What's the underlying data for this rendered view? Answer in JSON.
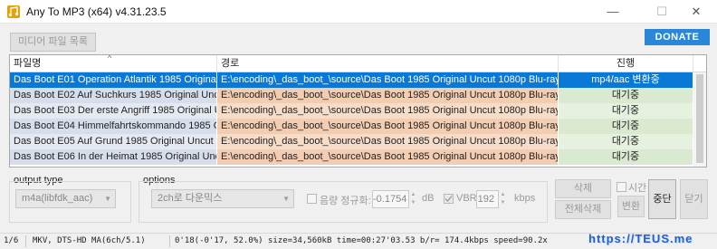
{
  "window": {
    "title": "Any To MP3 (x64) v4.31.23.5",
    "minimize": "—",
    "maximize": "☐",
    "close": "✕"
  },
  "toolbar": {
    "media_list_label": "미디어 파일 목록",
    "donate_label": "DONATE"
  },
  "grid": {
    "columns": [
      "파일명",
      "경로",
      "진행"
    ],
    "rows": [
      {
        "name": "Das Boot E01 Operation Atlantik 1985 Original ...",
        "path": "E:\\encoding\\_das_boot_\\source\\Das Boot 1985 Original Uncut 1080p Blu-ray Re...",
        "status": "mp4/aac 변환중",
        "selected": true
      },
      {
        "name": "Das Boot E02 Auf Suchkurs 1985 Original Uncut...",
        "path": "E:\\encoding\\_das_boot_\\source\\Das Boot 1985 Original Uncut 1080p Blu-ray Re...",
        "status": "대기중",
        "selected": false
      },
      {
        "name": "Das Boot E03 Der erste Angriff 1985 Original U...",
        "path": "E:\\encoding\\_das_boot_\\source\\Das Boot 1985 Original Uncut 1080p Blu-ray Re...",
        "status": "대기중",
        "selected": false
      },
      {
        "name": "Das Boot E04 Himmelfahrtskommando 1985 Or...",
        "path": "E:\\encoding\\_das_boot_\\source\\Das Boot 1985 Original Uncut 1080p Blu-ray Re...",
        "status": "대기중",
        "selected": false
      },
      {
        "name": "Das Boot E05 Auf Grund 1985 Original Uncut 1...",
        "path": "E:\\encoding\\_das_boot_\\source\\Das Boot 1985 Original Uncut 1080p Blu-ray Re...",
        "status": "대기중",
        "selected": false
      },
      {
        "name": "Das Boot E06 In der Heimat 1985 Original Uncu...",
        "path": "E:\\encoding\\_das_boot_\\source\\Das Boot 1985 Original Uncut 1080p Blu-ray Re...",
        "status": "대기중",
        "selected": false
      }
    ]
  },
  "output": {
    "group_label": "output type",
    "format": "m4a(libfdk_aac)"
  },
  "options": {
    "group_label": "options",
    "downmix": "2ch로 다운믹스",
    "normalize_label": "음량 정규화:",
    "normalize_value": "-0.1754",
    "db_unit": "dB",
    "vbr_label": "VBR",
    "vbr_value": "192",
    "kbps_unit": "kbps"
  },
  "actions": {
    "delete": "삭제",
    "delete_all": "전체삭제",
    "time_label": "시간",
    "convert": "변환",
    "stop": "중단",
    "close": "닫기"
  },
  "status": {
    "index": "1/6",
    "info": "MKV, DTS-HD MA(6ch/5.1)",
    "progress": "0'18(-0'17, 52.0%) size=34,560kB time=00:27'03.53 b/r= 174.4kbps speed=90.2x"
  },
  "watermark": "https://TEUS.me",
  "colors": {
    "selected_row": "#0a78d7",
    "name_col": "#d6deeb",
    "path_col": "#f2cdb1",
    "status_col": "#d9ead1",
    "donate": "#2a86d8"
  }
}
